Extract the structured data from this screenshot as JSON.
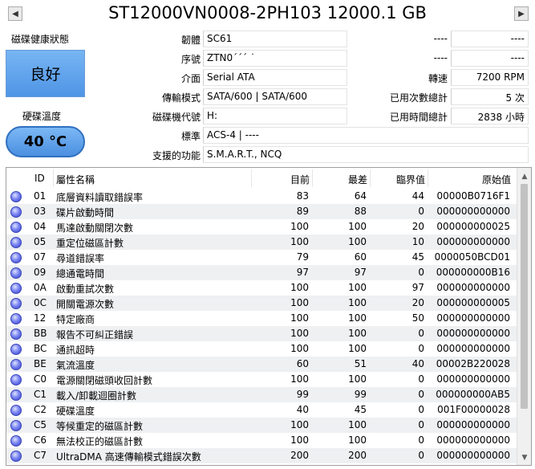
{
  "window": {
    "title": "ST12000VN0008-2PH103 12000.1 GB",
    "prev_icon": "triangle-left",
    "next_icon": "triangle-right"
  },
  "health": {
    "label": "磁碟健康狀態",
    "status": "良好",
    "color": "#5aa0ec"
  },
  "temperature": {
    "label": "硬碟溫度",
    "value": "40 °C"
  },
  "info": {
    "firmware": {
      "label": "韌體",
      "value": "SC61"
    },
    "serial": {
      "label": "序號",
      "value": "ZTN0´´´  ˙"
    },
    "interface": {
      "label": "介面",
      "value": "Serial ATA"
    },
    "transfer": {
      "label": "傳輸模式",
      "value": "SATA/600 | SATA/600"
    },
    "drive_letter": {
      "label": "磁碟機代號",
      "value": "H:"
    },
    "standard": {
      "label": "標準",
      "value": "ACS-4 | ----"
    },
    "features": {
      "label": "支援的功能",
      "value": "S.M.A.R.T., NCQ"
    },
    "right1": {
      "label": "----",
      "value": "----"
    },
    "right2": {
      "label": "----",
      "value": "----"
    },
    "rotation": {
      "label": "轉速",
      "value": "7200 RPM"
    },
    "power_count": {
      "label": "已用次數總計",
      "value": "5 次"
    },
    "power_hours": {
      "label": "已用時間總計",
      "value": "2838 小時"
    }
  },
  "table": {
    "headers": {
      "id": "ID",
      "name": "屬性名稱",
      "current": "目前",
      "worst": "最差",
      "threshold": "臨界值",
      "raw": "原始值"
    },
    "rows": [
      {
        "id": "01",
        "name": "底層資料讀取錯誤率",
        "current": "83",
        "worst": "64",
        "threshold": "44",
        "raw": "00000B0716F1"
      },
      {
        "id": "03",
        "name": "碟片啟動時間",
        "current": "89",
        "worst": "88",
        "threshold": "0",
        "raw": "000000000000"
      },
      {
        "id": "04",
        "name": "馬達啟動關閉次數",
        "current": "100",
        "worst": "100",
        "threshold": "20",
        "raw": "000000000025"
      },
      {
        "id": "05",
        "name": "重定位磁區計數",
        "current": "100",
        "worst": "100",
        "threshold": "10",
        "raw": "000000000000"
      },
      {
        "id": "07",
        "name": "尋道錯誤率",
        "current": "79",
        "worst": "60",
        "threshold": "45",
        "raw": "0000050BCD01"
      },
      {
        "id": "09",
        "name": "總通電時間",
        "current": "97",
        "worst": "97",
        "threshold": "0",
        "raw": "000000000B16"
      },
      {
        "id": "0A",
        "name": "啟動重試次數",
        "current": "100",
        "worst": "100",
        "threshold": "97",
        "raw": "000000000000"
      },
      {
        "id": "0C",
        "name": "開關電源次數",
        "current": "100",
        "worst": "100",
        "threshold": "20",
        "raw": "000000000005"
      },
      {
        "id": "12",
        "name": "特定廠商",
        "current": "100",
        "worst": "100",
        "threshold": "50",
        "raw": "000000000000"
      },
      {
        "id": "BB",
        "name": "報告不可糾正錯誤",
        "current": "100",
        "worst": "100",
        "threshold": "0",
        "raw": "000000000000"
      },
      {
        "id": "BC",
        "name": "通訊超時",
        "current": "100",
        "worst": "100",
        "threshold": "0",
        "raw": "000000000000"
      },
      {
        "id": "BE",
        "name": "氣流溫度",
        "current": "60",
        "worst": "51",
        "threshold": "40",
        "raw": "00002B220028"
      },
      {
        "id": "C0",
        "name": "電源關閉磁頭收回計數",
        "current": "100",
        "worst": "100",
        "threshold": "0",
        "raw": "000000000000"
      },
      {
        "id": "C1",
        "name": "載入/卸載迴圈計數",
        "current": "99",
        "worst": "99",
        "threshold": "0",
        "raw": "000000000AB5"
      },
      {
        "id": "C2",
        "name": "硬碟溫度",
        "current": "40",
        "worst": "45",
        "threshold": "0",
        "raw": "001F00000028"
      },
      {
        "id": "C5",
        "name": "等候重定的磁區計數",
        "current": "100",
        "worst": "100",
        "threshold": "0",
        "raw": "000000000000"
      },
      {
        "id": "C6",
        "name": "無法校正的磁區計數",
        "current": "100",
        "worst": "100",
        "threshold": "0",
        "raw": "000000000000"
      },
      {
        "id": "C7",
        "name": "UltraDMA 高速傳輸模式錯誤次數",
        "current": "200",
        "worst": "200",
        "threshold": "0",
        "raw": "000000000000"
      }
    ]
  }
}
